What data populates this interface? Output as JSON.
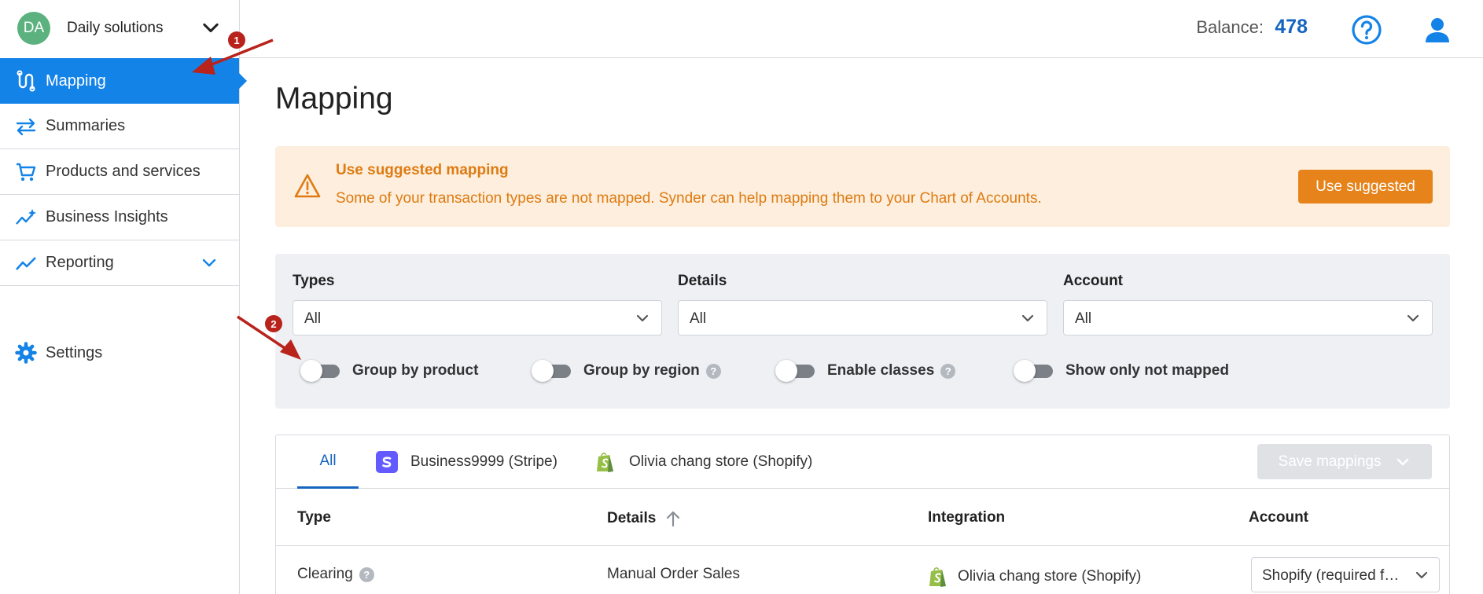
{
  "org": {
    "initials": "DA",
    "name": "Daily solutions"
  },
  "sidebar": {
    "items": [
      {
        "label": "Mapping",
        "icon": "mapping-icon",
        "active": true
      },
      {
        "label": "Summaries",
        "icon": "transfer-arrows-icon"
      },
      {
        "label": "Products and services",
        "icon": "cart-icon"
      },
      {
        "label": "Business Insights",
        "icon": "insights-icon"
      },
      {
        "label": "Reporting",
        "icon": "trend-line-icon"
      },
      {
        "label": "Settings",
        "icon": "gear-icon"
      }
    ]
  },
  "topbar": {
    "balance_label": "Balance:",
    "balance_value": "478"
  },
  "page": {
    "title": "Mapping"
  },
  "alert": {
    "title": "Use suggested mapping",
    "text": "Some of your transaction types are not mapped. Synder can help mapping them to your Chart of Accounts.",
    "button": "Use suggested"
  },
  "filters": {
    "types": {
      "label": "Types",
      "value": "All"
    },
    "details": {
      "label": "Details",
      "value": "All"
    },
    "account": {
      "label": "Account",
      "value": "All"
    },
    "toggles": [
      {
        "label": "Group by product",
        "on": false
      },
      {
        "label": "Group by region",
        "on": false,
        "help": "?"
      },
      {
        "label": "Enable classes",
        "on": false,
        "help": "?"
      },
      {
        "label": "Show only not mapped",
        "on": false
      }
    ]
  },
  "tabs": {
    "items": [
      {
        "label": "All"
      },
      {
        "label": "Business9999 (Stripe)",
        "icon": "stripe-logo-icon"
      },
      {
        "label": "Olivia chang store (Shopify)",
        "icon": "shopify-logo-icon"
      }
    ],
    "save_button": "Save mappings"
  },
  "table": {
    "headers": [
      "Type",
      "Details",
      "Integration",
      "Account"
    ],
    "rows": [
      {
        "type": "Clearing",
        "help": "?",
        "details": "Manual Order Sales",
        "integration": "Olivia chang store (Shopify)",
        "account": "Shopify (required for Synder)"
      }
    ]
  },
  "annotations": {
    "badge1": "1",
    "badge2": "2"
  },
  "colors": {
    "primary": "#1483e8",
    "warning": "#e6831a",
    "link": "#1565c0"
  }
}
